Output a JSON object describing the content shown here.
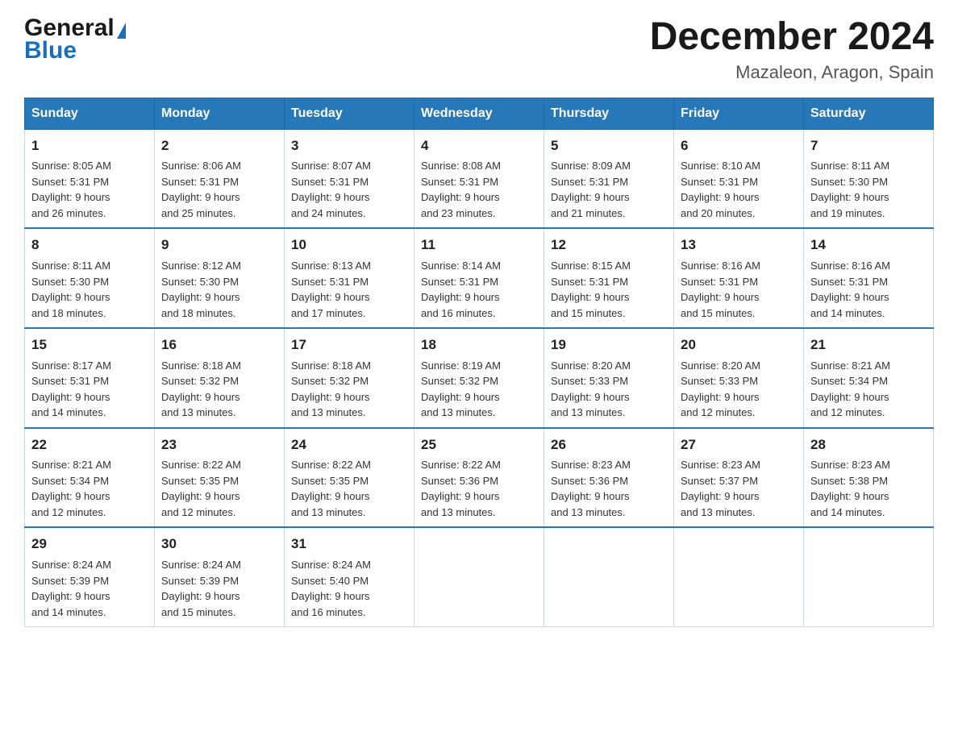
{
  "header": {
    "logo_general": "General",
    "logo_blue": "Blue",
    "month_year": "December 2024",
    "location": "Mazaleon, Aragon, Spain"
  },
  "days_of_week": [
    "Sunday",
    "Monday",
    "Tuesday",
    "Wednesday",
    "Thursday",
    "Friday",
    "Saturday"
  ],
  "weeks": [
    [
      {
        "day": "1",
        "sunrise": "8:05 AM",
        "sunset": "5:31 PM",
        "daylight": "9 hours and 26 minutes."
      },
      {
        "day": "2",
        "sunrise": "8:06 AM",
        "sunset": "5:31 PM",
        "daylight": "9 hours and 25 minutes."
      },
      {
        "day": "3",
        "sunrise": "8:07 AM",
        "sunset": "5:31 PM",
        "daylight": "9 hours and 24 minutes."
      },
      {
        "day": "4",
        "sunrise": "8:08 AM",
        "sunset": "5:31 PM",
        "daylight": "9 hours and 23 minutes."
      },
      {
        "day": "5",
        "sunrise": "8:09 AM",
        "sunset": "5:31 PM",
        "daylight": "9 hours and 21 minutes."
      },
      {
        "day": "6",
        "sunrise": "8:10 AM",
        "sunset": "5:31 PM",
        "daylight": "9 hours and 20 minutes."
      },
      {
        "day": "7",
        "sunrise": "8:11 AM",
        "sunset": "5:30 PM",
        "daylight": "9 hours and 19 minutes."
      }
    ],
    [
      {
        "day": "8",
        "sunrise": "8:11 AM",
        "sunset": "5:30 PM",
        "daylight": "9 hours and 18 minutes."
      },
      {
        "day": "9",
        "sunrise": "8:12 AM",
        "sunset": "5:30 PM",
        "daylight": "9 hours and 18 minutes."
      },
      {
        "day": "10",
        "sunrise": "8:13 AM",
        "sunset": "5:31 PM",
        "daylight": "9 hours and 17 minutes."
      },
      {
        "day": "11",
        "sunrise": "8:14 AM",
        "sunset": "5:31 PM",
        "daylight": "9 hours and 16 minutes."
      },
      {
        "day": "12",
        "sunrise": "8:15 AM",
        "sunset": "5:31 PM",
        "daylight": "9 hours and 15 minutes."
      },
      {
        "day": "13",
        "sunrise": "8:16 AM",
        "sunset": "5:31 PM",
        "daylight": "9 hours and 15 minutes."
      },
      {
        "day": "14",
        "sunrise": "8:16 AM",
        "sunset": "5:31 PM",
        "daylight": "9 hours and 14 minutes."
      }
    ],
    [
      {
        "day": "15",
        "sunrise": "8:17 AM",
        "sunset": "5:31 PM",
        "daylight": "9 hours and 14 minutes."
      },
      {
        "day": "16",
        "sunrise": "8:18 AM",
        "sunset": "5:32 PM",
        "daylight": "9 hours and 13 minutes."
      },
      {
        "day": "17",
        "sunrise": "8:18 AM",
        "sunset": "5:32 PM",
        "daylight": "9 hours and 13 minutes."
      },
      {
        "day": "18",
        "sunrise": "8:19 AM",
        "sunset": "5:32 PM",
        "daylight": "9 hours and 13 minutes."
      },
      {
        "day": "19",
        "sunrise": "8:20 AM",
        "sunset": "5:33 PM",
        "daylight": "9 hours and 13 minutes."
      },
      {
        "day": "20",
        "sunrise": "8:20 AM",
        "sunset": "5:33 PM",
        "daylight": "9 hours and 12 minutes."
      },
      {
        "day": "21",
        "sunrise": "8:21 AM",
        "sunset": "5:34 PM",
        "daylight": "9 hours and 12 minutes."
      }
    ],
    [
      {
        "day": "22",
        "sunrise": "8:21 AM",
        "sunset": "5:34 PM",
        "daylight": "9 hours and 12 minutes."
      },
      {
        "day": "23",
        "sunrise": "8:22 AM",
        "sunset": "5:35 PM",
        "daylight": "9 hours and 12 minutes."
      },
      {
        "day": "24",
        "sunrise": "8:22 AM",
        "sunset": "5:35 PM",
        "daylight": "9 hours and 13 minutes."
      },
      {
        "day": "25",
        "sunrise": "8:22 AM",
        "sunset": "5:36 PM",
        "daylight": "9 hours and 13 minutes."
      },
      {
        "day": "26",
        "sunrise": "8:23 AM",
        "sunset": "5:36 PM",
        "daylight": "9 hours and 13 minutes."
      },
      {
        "day": "27",
        "sunrise": "8:23 AM",
        "sunset": "5:37 PM",
        "daylight": "9 hours and 13 minutes."
      },
      {
        "day": "28",
        "sunrise": "8:23 AM",
        "sunset": "5:38 PM",
        "daylight": "9 hours and 14 minutes."
      }
    ],
    [
      {
        "day": "29",
        "sunrise": "8:24 AM",
        "sunset": "5:39 PM",
        "daylight": "9 hours and 14 minutes."
      },
      {
        "day": "30",
        "sunrise": "8:24 AM",
        "sunset": "5:39 PM",
        "daylight": "9 hours and 15 minutes."
      },
      {
        "day": "31",
        "sunrise": "8:24 AM",
        "sunset": "5:40 PM",
        "daylight": "9 hours and 16 minutes."
      },
      null,
      null,
      null,
      null
    ]
  ],
  "labels": {
    "sunrise": "Sunrise:",
    "sunset": "Sunset:",
    "daylight": "Daylight:"
  }
}
